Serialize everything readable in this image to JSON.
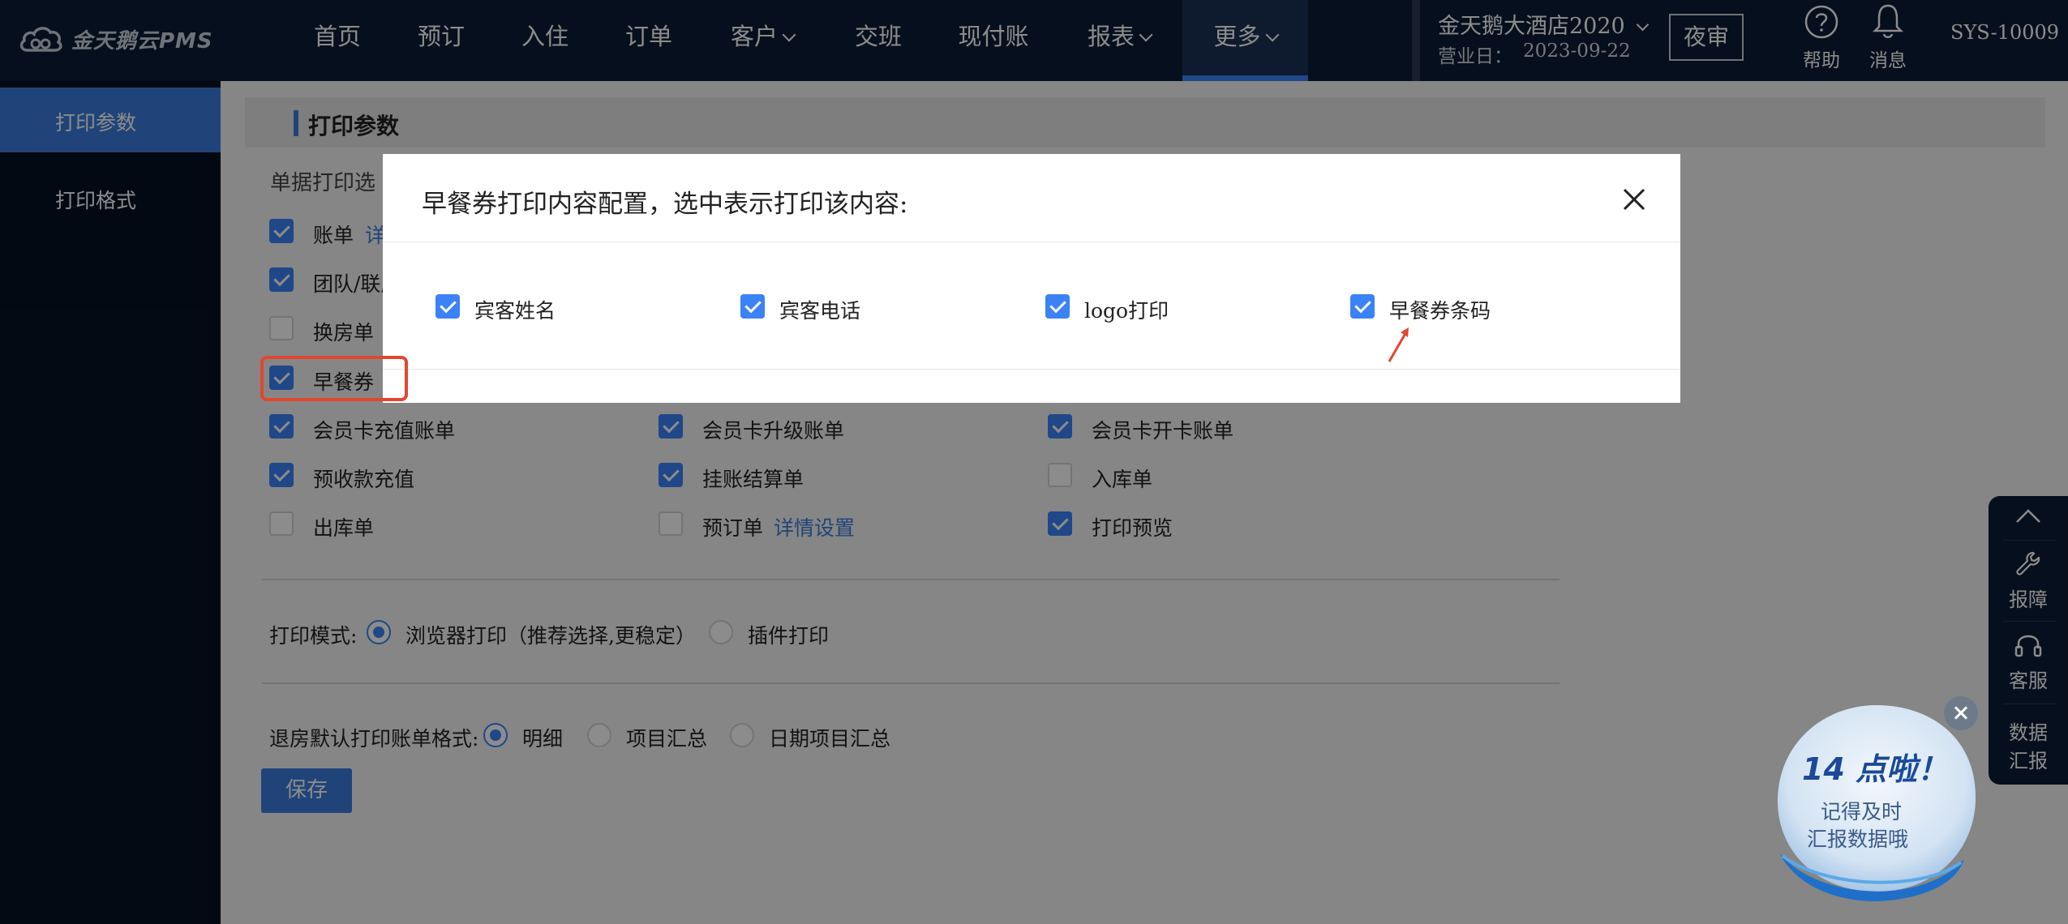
{
  "brand": {
    "name": "金天鹅云PMS"
  },
  "nav": {
    "items": [
      {
        "label": "首页"
      },
      {
        "label": "预订"
      },
      {
        "label": "入住"
      },
      {
        "label": "订单"
      },
      {
        "label": "客户"
      },
      {
        "label": "交班"
      },
      {
        "label": "现付账"
      },
      {
        "label": "报表"
      },
      {
        "label": "更多"
      }
    ]
  },
  "header": {
    "hotel_name": "金天鹅大酒店2020",
    "business_day_label": "营业日：",
    "business_day_value": "2023-09-22",
    "night_audit": "夜审",
    "help": "帮助",
    "messages": "消息",
    "user_id": "SYS-10009"
  },
  "sidebar": {
    "items": [
      {
        "label": "打印参数",
        "active": true
      },
      {
        "label": "打印格式",
        "active": false
      }
    ]
  },
  "page": {
    "section_title": "打印参数",
    "doc_options_label": "单据打印选",
    "docs": [
      {
        "label": "账单",
        "checked": true,
        "link": "详"
      },
      {
        "label": "团队/联房",
        "checked": true
      },
      {
        "label": "换房单",
        "checked": false
      },
      {
        "label": "早餐券",
        "checked": true
      },
      {
        "label": "会员卡充值账单",
        "checked": true
      },
      {
        "label": "会员卡升级账单",
        "checked": true
      },
      {
        "label": "会员卡开卡账单",
        "checked": true
      },
      {
        "label": "预收款充值",
        "checked": true
      },
      {
        "label": "挂账结算单",
        "checked": true
      },
      {
        "label": "入库单",
        "checked": false
      },
      {
        "label": "出库单",
        "checked": false
      },
      {
        "label": "预订单",
        "checked": false,
        "link": "详情设置"
      },
      {
        "label": "打印预览",
        "checked": true
      }
    ],
    "print_mode": {
      "label": "打印模式:",
      "options": [
        {
          "label": "浏览器打印（推荐选择,更稳定）",
          "selected": true
        },
        {
          "label": "插件打印",
          "selected": false
        }
      ]
    },
    "checkout_format": {
      "label": "退房默认打印账单格式:",
      "options": [
        {
          "label": "明细",
          "selected": true
        },
        {
          "label": "项目汇总",
          "selected": false
        },
        {
          "label": "日期项目汇总",
          "selected": false
        }
      ]
    },
    "save": "保存"
  },
  "modal": {
    "title": "早餐券打印内容配置，选中表示打印该内容:",
    "options": [
      {
        "label": "宾客姓名",
        "checked": true
      },
      {
        "label": "宾客电话",
        "checked": true
      },
      {
        "label": "logo打印",
        "checked": true
      },
      {
        "label": "早餐券条码",
        "checked": true
      }
    ]
  },
  "right_toolbar": {
    "items": [
      {
        "label": "报障",
        "icon": "wrench-icon"
      },
      {
        "label": "客服",
        "icon": "headset-icon"
      },
      {
        "label_line1": "数据",
        "label_line2": "汇报"
      }
    ]
  },
  "promo": {
    "headline": "14 点啦！",
    "line1": "记得及时",
    "line2": "汇报数据哦"
  },
  "colors": {
    "topbar": "#0c1c35",
    "sidebar": "#061222",
    "accent": "#3b7ddd",
    "highlight": "#e2462e"
  }
}
